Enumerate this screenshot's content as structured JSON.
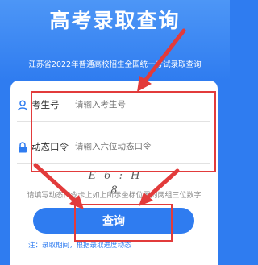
{
  "header": {
    "title": "高考录取查询",
    "subtitle": "江苏省2022年普通高校招生全国统一考试录取查询"
  },
  "form": {
    "exam_id_label": "考生号",
    "exam_id_placeholder": "请输入考生号",
    "code_label": "动态口令",
    "code_placeholder": "请输入六位动态口令",
    "captcha_text": "E 6 : H 8",
    "hint": "请填写动态口令卡上如上所示坐标位置的两组三位数字",
    "submit_label": "查询",
    "note": "注：录取期间，根据录取进度动态"
  },
  "icons": {
    "user": "user-icon",
    "lock": "lock-icon"
  },
  "colors": {
    "primary": "#2f7cf0",
    "highlight": "#e23b3b"
  }
}
